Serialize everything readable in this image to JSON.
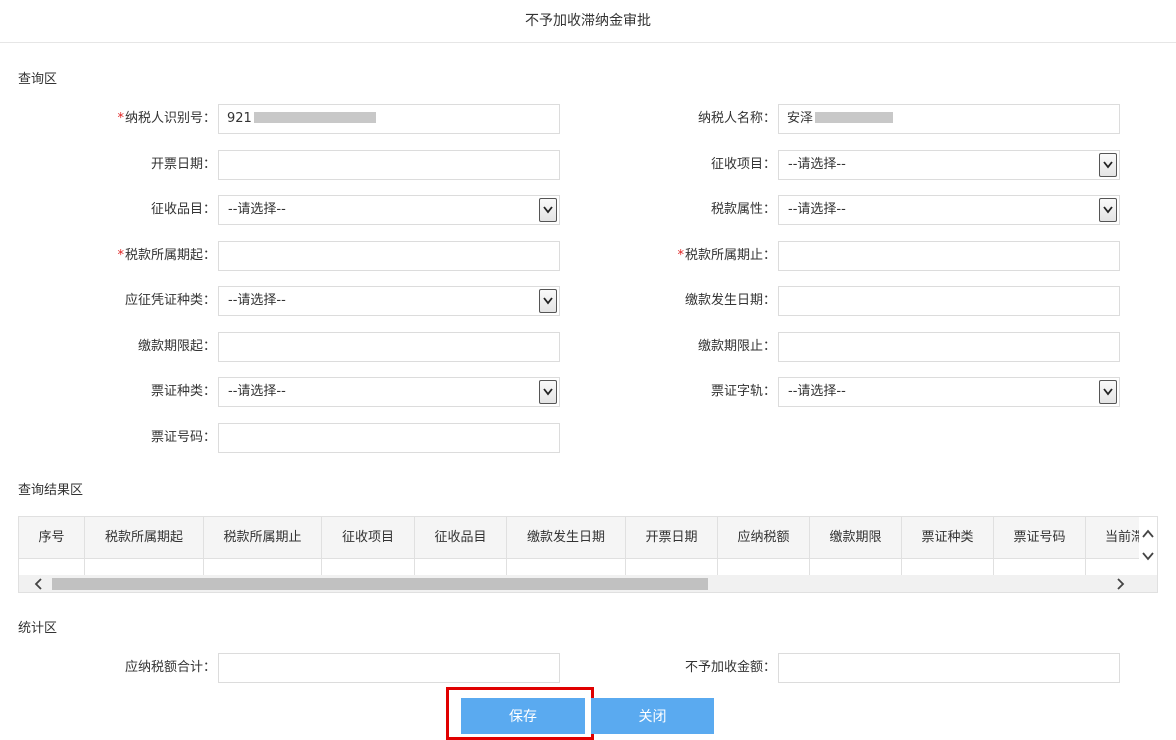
{
  "window": {
    "title": "不予加收滞纳金审批"
  },
  "query": {
    "section_title": "查询区",
    "required_mark": "*",
    "fields": {
      "taxpayer_id": {
        "label": "纳税人识别号：",
        "value": "921"
      },
      "taxpayer_name": {
        "label": "纳税人名称：",
        "value": "安泽"
      },
      "invoice_date": {
        "label": "开票日期：",
        "value": ""
      },
      "levy_item": {
        "label": "征收项目：",
        "value": "--请选择--"
      },
      "levy_category": {
        "label": "征收品目：",
        "value": "--请选择--"
      },
      "tax_attribute": {
        "label": "税款属性：",
        "value": "--请选择--"
      },
      "period_start": {
        "label": "税款所属期起：",
        "value": ""
      },
      "period_end": {
        "label": "税款所属期止：",
        "value": ""
      },
      "voucher_type": {
        "label": "应征凭证种类：",
        "value": "--请选择--"
      },
      "payment_date": {
        "label": "缴款发生日期：",
        "value": ""
      },
      "deadline_start": {
        "label": "缴款期限起：",
        "value": ""
      },
      "deadline_end": {
        "label": "缴款期限止：",
        "value": ""
      },
      "ticket_type": {
        "label": "票证种类：",
        "value": "--请选择--"
      },
      "ticket_track": {
        "label": "票证字轨：",
        "value": "--请选择--"
      },
      "ticket_number": {
        "label": "票证号码：",
        "value": ""
      }
    }
  },
  "results": {
    "section_title": "查询结果区",
    "columns": [
      "序号",
      "税款所属期起",
      "税款所属期止",
      "征收项目",
      "征收品目",
      "缴款发生日期",
      "开票日期",
      "应纳税额",
      "缴款期限",
      "票证种类",
      "票证号码",
      "当前滞"
    ]
  },
  "stats": {
    "section_title": "统计区",
    "total_tax": {
      "label": "应纳税额合计：",
      "value": ""
    },
    "exempt_amount": {
      "label": "不予加收金额：",
      "value": ""
    }
  },
  "buttons": {
    "save": "保存",
    "close": "关闭"
  },
  "colors": {
    "button": "#5aaaf0",
    "highlight": "#e00000",
    "required": "#e02020"
  }
}
